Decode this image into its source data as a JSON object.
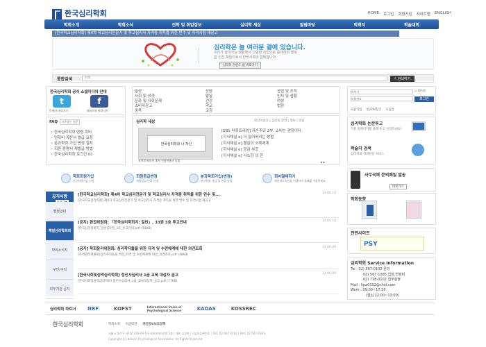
{
  "header": {
    "logo_kr": "한국심리학회",
    "logo_en": "Korean Psychological Association",
    "util": [
      "HOME",
      "로그인",
      "회원가입",
      "사이트맵",
      "ENGLISH"
    ],
    "nav": [
      "학회소개",
      "학회소식",
      "진학 및 취업정보",
      "심리학 세상",
      "알림마당",
      "학회지",
      "학술대회"
    ],
    "ticker": "[한국학교심리학회] 제4차 학교심리전문가 및 학교심리사 자격증 취득을 위한 연수 및 자격시험 재공고"
  },
  "banner": {
    "title": "심리학은 늘 여러분 곁에 있습니다.",
    "sub": "우리가 살아가는 생활에서 다양한 직업으로 존재하며 행복한 인간 체험으로서 한국사회와 함께합니다.",
    "button": "심리학 관련도 합 바로가기"
  },
  "search": {
    "label": "통합검색",
    "placeholder": "검색",
    "button": "검색하기"
  },
  "sns": {
    "title": "한국심리학회 공식 소셜미디어 안내",
    "twitter": "트위터 바로가기",
    "facebook": "페이스북 바로가기"
  },
  "faq": {
    "title": "FAQ",
    "tag": "자주묻는 질문",
    "items": [
      "한국심리학회 연령 회비",
      "연회비 계산서 발급 요청",
      "분과학회 가입 변경 절차",
      "회원 증명서 재발급 방법",
      "한국심리학회 로그인 ID"
    ]
  },
  "categories": {
    "col1": [
      "임상",
      "사회 및 성격",
      "문화 및 사회문제",
      "소비자광고",
      "중독"
    ],
    "col2": [
      "상담",
      "발달",
      "건강",
      "학교",
      "코칭"
    ],
    "col3": [
      "산업 및 조직",
      "인지 및 생물",
      "여성",
      "법정",
      ""
    ]
  },
  "world": {
    "title": "심리학 세상",
    "tabs": "최신이야기 | 심리학 강연 | 정보 | 방송",
    "img_text": "한국심리학회 나 자신",
    "caption": "과학로 배아이 좋게 만들어줄까 방법",
    "items": [
      "[EBS 다큐프라임] 자존주의 2부. 소비는 감정이다.",
      "[지식채널 e] 더 잘어버리는 방법",
      "[지식채널 e] 행길이 소록에게",
      "[지식채널 e] 공감 부조",
      "[지식채널 e] 사소한 의 한"
    ],
    "page": "◀ ▶"
  },
  "quick": [
    {
      "label": "학회회원가입",
      "sub": "신규회원가입 신청"
    },
    {
      "label": "회원등급변경",
      "sub": "회원등급 변경 안내"
    },
    {
      "label": "분과학회가입(변경)",
      "sub": "분과학회 가입 및 변경 방법"
    },
    {
      "label": "회비결제하기",
      "sub": "회원비스지원을 이용하여 결제를 이용하세요."
    }
  ],
  "notice": {
    "tab_active": "공지사항",
    "more": "더보기 ▶",
    "tabs": [
      "행정안내",
      "채널심리학회회",
      "학회소식지",
      "구인/구직",
      "외부기관 공지"
    ],
    "items": [
      {
        "title": "[한국학교심리학회] 제4차 학교심리전문가 및 학교심리사 자격증 취득을 위한 연수 및...",
        "date": "14.06.10",
        "body": "[한국학교심리학회] 제4차 학교심리전문가 및 학교심리사 자격증 취득을 위한 연수 및 자격시험 재공고"
      },
      {
        "title": "[공지] 편집위원회: 「한국심리학회지: 일반」, 33권 3호 투고안내",
        "date": "14.06.10",
        "body": "[한국심리학회지_일반]33권_3호_투고안내.pdf (92KB)"
      },
      {
        "title": "[공지] 학회윤리위원회: 심리학자들을 위한 자격 및 수련체계에 대한 의견조회",
        "date": "14.06.09",
        "body": "[자격관리위원회]심리학자들을 위한_자격 및 수련체계에 대한_의견조회.pdf (48KB)"
      },
      {
        "title": "[한국사회및성격심리학회] 정신사심리사 1급 교육 대상자 공고",
        "date": "14.06.09",
        "body": "[한국사회및성격심리학회] 정신사심리사_1급_교육대상자_공고.pdf (77KB)"
      }
    ]
  },
  "login": {
    "id": "아이디",
    "pw": "비밀번호",
    "save": "ID저장",
    "button": "로그인",
    "links": [
      "회원가입",
      "ID/PW찾기",
      "도움말"
    ]
  },
  "paper": {
    "title": "심리학회 논문투고",
    "sub": "학회 홈페이지를 통해 투고 신청하세요!",
    "title2": "학술지 검색",
    "sub2": "심리학회 학회원용 서비스"
  },
  "mobile": {
    "title": "사무국에 문의메일 발송",
    "button": "바로가기"
  },
  "journal": {
    "title": "학회동향"
  },
  "related": {
    "title": "관련사이트",
    "psy": "PSY"
  },
  "service": {
    "title": "심리학회 Service Information",
    "lines": [
      "Tel : 02) 567-0102 문의",
      "02) 567-1085 입회,연회비",
      "02) 738-0102 업무총괄",
      "Mail : kpa0102@chol.com",
      "Work : 09:00~17:30",
      "(점심 12:00~13:00)"
    ]
  },
  "partners": {
    "label": "심리학회 파트너",
    "logos": [
      "NRF",
      "KOFST",
      "International Union of Psychological Science",
      "KAOAS",
      "KOSSREC"
    ]
  },
  "footer": {
    "logo": "한국심리학회",
    "links": [
      "학회소개",
      "이용약관",
      "개인정보보호정책"
    ],
    "addr": "서울시 종로구 사직동 209-49 한국사회과학자료원 5층 | 대표 김경희 | 사업자등록번호 | TEL: 02-567-0102 | FAX: 02-567-0103",
    "copy": "Copyright (C) Korean Psychological Association. All Rights Reserved"
  },
  "colors": {
    "brand": "#2a5fa8",
    "accent": "#2b8fd0"
  }
}
